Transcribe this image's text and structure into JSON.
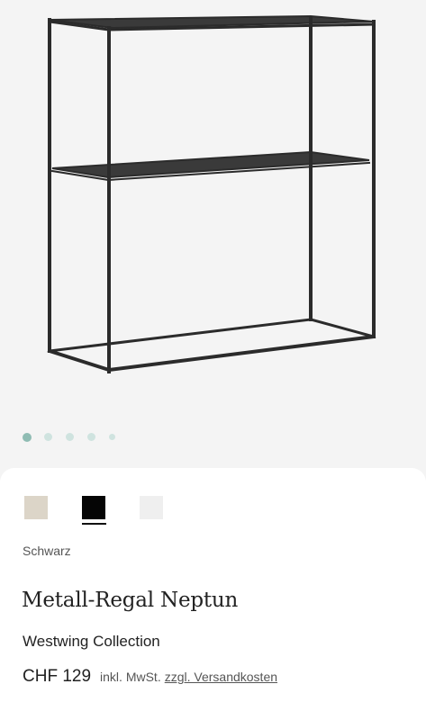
{
  "gallery": {
    "slide_count": 5,
    "active_index": 0,
    "image_alt": "Metall-Regal Neptun"
  },
  "swatches": [
    {
      "name": "beige",
      "color": "#dcd5c8"
    },
    {
      "name": "schwarz",
      "color": "#050505",
      "selected": true
    },
    {
      "name": "weiss",
      "color": "#efefef"
    }
  ],
  "product": {
    "selected_color": "Schwarz",
    "title": "Metall-Regal Neptun",
    "brand": "Westwing Collection",
    "price": "CHF 129",
    "tax_note": "inkl. MwSt.",
    "shipping_link": "zzgl. Versandkosten"
  },
  "colors": {
    "accent_dot": "#8fbcb3",
    "frame": "#2b2b2b",
    "background": "#f4f4f4"
  }
}
